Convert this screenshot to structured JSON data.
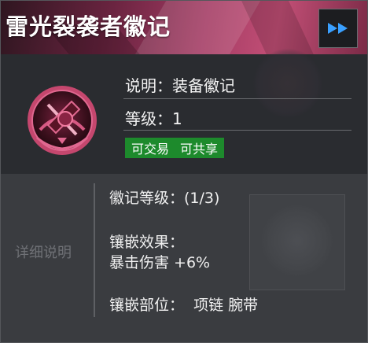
{
  "header": {
    "title": "雷光裂袭者徽记",
    "fast_forward_icon": "fast-forward-icon"
  },
  "info": {
    "description": "说明：装备徽记",
    "level": "等级：1",
    "tags": [
      "可交易",
      "可共享"
    ],
    "tag_color": "#1d8a2c"
  },
  "detail": {
    "section_label": "详细说明",
    "emblem_level": "徽记等级：(1/3)",
    "inlay_effect_label": "镶嵌效果：",
    "inlay_effect_value": "暴击伤害 +6%",
    "inlay_slots": "镶嵌部位：  项链 腕带"
  },
  "colors": {
    "header_accent": "#c24f76",
    "ff_arrow": "#3aa0ff"
  }
}
